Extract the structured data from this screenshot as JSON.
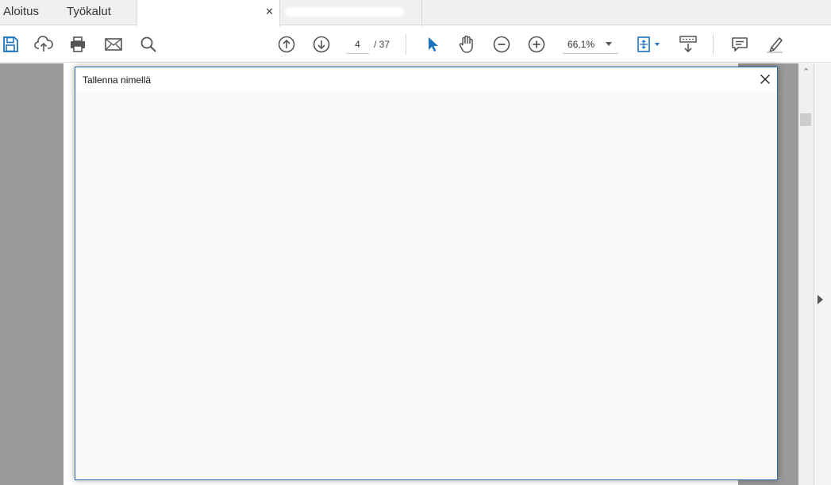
{
  "tabs": {
    "home_label": "Aloitus",
    "tools_label": "Työkalut",
    "doc1_title": "",
    "doc2_title": "",
    "close_glyph": "✕"
  },
  "toolbar": {
    "icons": [
      "save-icon",
      "cloud-upload-icon",
      "print-icon",
      "email-icon",
      "search-icon",
      "previous-page-icon",
      "next-page-icon",
      "select-cursor-icon",
      "hand-tool-icon",
      "zoom-out-icon",
      "zoom-in-icon",
      "fit-page-icon",
      "scroll-mode-icon",
      "comment-icon",
      "highlight-pen-icon"
    ],
    "page_current": "4",
    "page_total": "/ 37",
    "zoom": "66,1%"
  },
  "dialog": {
    "title": "Tallenna nimellä"
  },
  "colors": {
    "accent": "#1e73be",
    "dialog_border": "#2b6cb0",
    "doc_background": "#9a9a9a"
  }
}
